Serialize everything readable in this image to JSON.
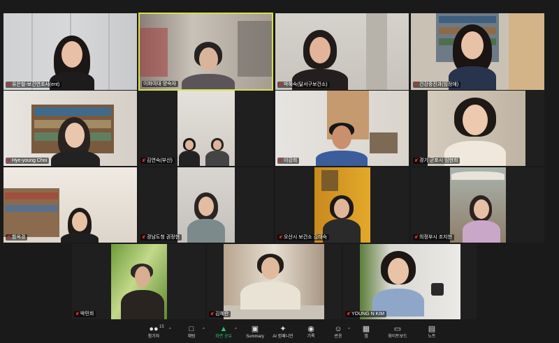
{
  "participants": [
    {
      "name": "유은철-보건연조사(ent)",
      "muted": true
    },
    {
      "name": "이화여대 양숙자",
      "muted": false,
      "active": true
    },
    {
      "name": "박혜숙(달서구보건소)",
      "muted": true
    },
    {
      "name": "건강증진과(임정애)",
      "muted": true
    },
    {
      "name": "Hye-young Choi",
      "muted": true
    },
    {
      "name": "김연숙(부산)",
      "muted": true
    },
    {
      "name": "이강희",
      "muted": true
    },
    {
      "name": "경기 군포시 임현희",
      "muted": true
    },
    {
      "name": "함옥경",
      "muted": true
    },
    {
      "name": "경남도청 권정현",
      "muted": true
    },
    {
      "name": "오산시 보건소 김태숙",
      "muted": true
    },
    {
      "name": "의정부시 조지현",
      "muted": true
    },
    {
      "name": "박민희",
      "muted": true
    },
    {
      "name": "김혜란",
      "muted": true
    },
    {
      "name": "YOUNG N KIM",
      "muted": true
    }
  ],
  "toolbar": {
    "participants_count": "15",
    "participants": "참가자",
    "chat": "채팅",
    "share": "화면 공유",
    "summary": "Summary",
    "ai": "AI 컴패니언",
    "record": "기록",
    "reactions": "반응",
    "apps": "앱",
    "whiteboard": "화이트보드",
    "notes": "노트"
  }
}
